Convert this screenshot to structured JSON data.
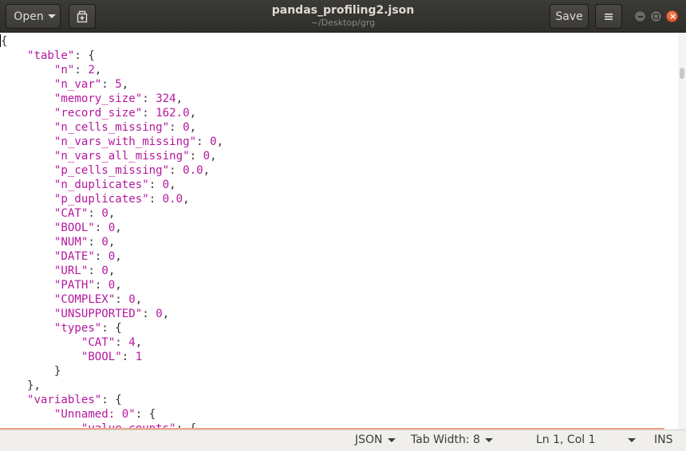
{
  "headerbar": {
    "open_label": "Open",
    "title": "pandas_profiling2.json",
    "subtitle": "~/Desktop/grg",
    "save_label": "Save"
  },
  "editor": {
    "lines": [
      "{",
      "    \"table\": {",
      "        \"n\": 2,",
      "        \"n_var\": 5,",
      "        \"memory_size\": 324,",
      "        \"record_size\": 162.0,",
      "        \"n_cells_missing\": 0,",
      "        \"n_vars_with_missing\": 0,",
      "        \"n_vars_all_missing\": 0,",
      "        \"p_cells_missing\": 0.0,",
      "        \"n_duplicates\": 0,",
      "        \"p_duplicates\": 0.0,",
      "        \"CAT\": 0,",
      "        \"BOOL\": 0,",
      "        \"NUM\": 0,",
      "        \"DATE\": 0,",
      "        \"URL\": 0,",
      "        \"PATH\": 0,",
      "        \"COMPLEX\": 0,",
      "        \"UNSUPPORTED\": 0,",
      "        \"types\": {",
      "            \"CAT\": 4,",
      "            \"BOOL\": 1",
      "        }",
      "    },",
      "    \"variables\": {",
      "        \"Unnamed: 0\": {",
      "            \"value_counts\": {"
    ]
  },
  "statusbar": {
    "language": "JSON",
    "tab_width": "Tab Width: 8",
    "position": "Ln 1, Col 1",
    "mode": "INS"
  },
  "colors": {
    "string": "#b5179e",
    "header": "#2f2e2b",
    "close": "#e25b2c"
  }
}
